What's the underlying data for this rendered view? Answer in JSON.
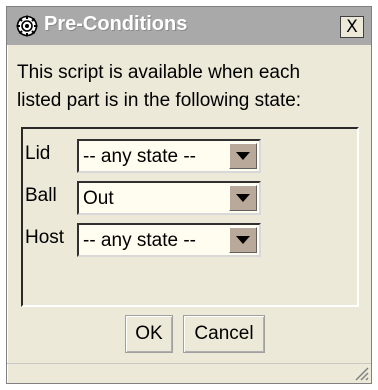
{
  "window": {
    "title": "Pre-Conditions",
    "close_label": "X",
    "title_icon": "gear-icon"
  },
  "message": {
    "line1": "This script is available when each",
    "line2": "listed part is in the following state:"
  },
  "conditions": [
    {
      "part": "Lid",
      "state": "-- any state --"
    },
    {
      "part": "Ball",
      "state": "Out"
    },
    {
      "part": "Host",
      "state": "-- any state --"
    }
  ],
  "buttons": {
    "ok": "OK",
    "cancel": "Cancel"
  }
}
